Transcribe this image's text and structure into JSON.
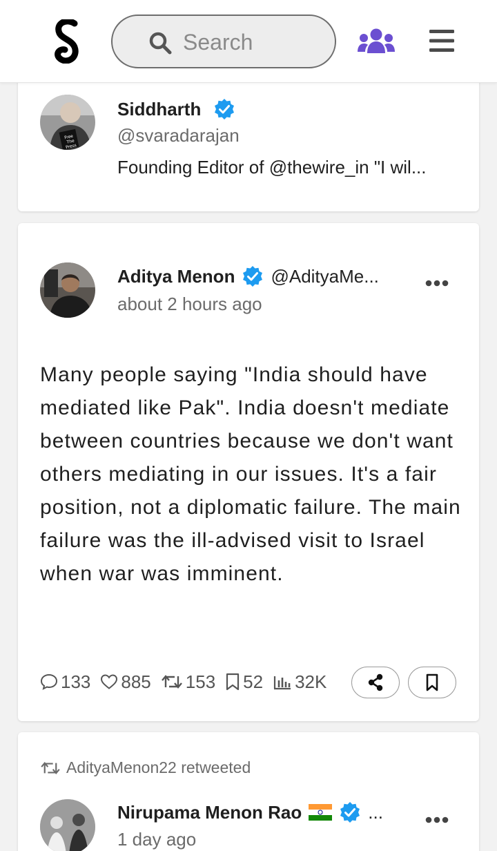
{
  "header": {
    "logo": "S",
    "search_placeholder": "Search",
    "icons": [
      "search-icon",
      "people-icon",
      "hamburger-menu-icon"
    ],
    "accent_color": "#6b4fd1"
  },
  "profile_card": {
    "name": "Siddharth",
    "handle": "@svaradarajan",
    "bio": "Founding Editor of @thewire_in \"I wil...",
    "verified": true
  },
  "tweet": {
    "author": "Aditya Menon",
    "handle": "@AdityaMe...",
    "time": "about 2 hours ago",
    "text": "Many people saying \"India should have mediated like Pak\". India doesn't mediate between countries because we don't want others mediating in our issues. It's a fair position, not a diplomatic failure. The main failure was the ill-advised visit to Israel when war was imminent.",
    "stats": {
      "replies": "133",
      "likes": "885",
      "retweets": "153",
      "bookmarks": "52",
      "views": "32K"
    }
  },
  "retweet_card": {
    "retweet_label": "AdityaMenon22 retweeted",
    "author": "Nirupama Menon Rao",
    "flag": "🇮🇳",
    "overflow": "...",
    "time": "1 day ago"
  },
  "colors": {
    "verified_blue": "#1d9bf0",
    "text": "#1f1f1f",
    "muted": "#6b6b6b"
  }
}
